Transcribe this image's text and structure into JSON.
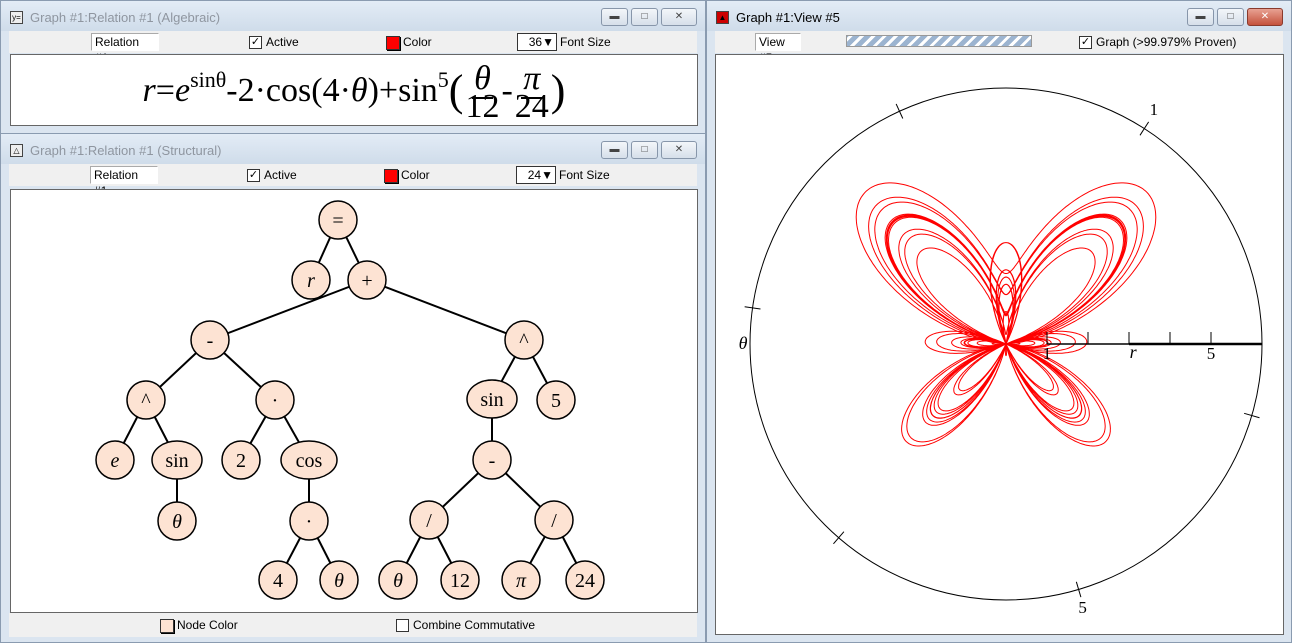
{
  "algebraic": {
    "title": "Graph #1:Relation #1 (Algebraic)",
    "title_icon": "y=",
    "relation_name": "Relation #1",
    "active_label": "Active",
    "active_checked": true,
    "color_label": "Color",
    "color": "#ff0000",
    "font_size": "36",
    "font_size_label": "Font Size",
    "equation": {
      "lhs": "r",
      "eq": "=",
      "base": "e",
      "exp": "sinθ",
      "mid": "-2·cos(4·",
      "theta": "θ",
      "close": ")+sin",
      "pow": "5",
      "lparen": "(",
      "num1": "θ",
      "den1": "12",
      "minus": "-",
      "num2": "π",
      "den2": "24",
      "rparen": ")"
    }
  },
  "structural": {
    "title": "Graph #1:Relation #1 (Structural)",
    "relation_name": "Relation #1",
    "active_label": "Active",
    "active_checked": true,
    "color_label": "Color",
    "color": "#ff0000",
    "font_size": "24",
    "font_size_label": "Font Size",
    "node_color_label": "Node Color",
    "node_color": "#fde3d3",
    "combine_commutative_label": "Combine Commutative",
    "combine_commutative_checked": false,
    "tree": [
      {
        "id": "n0",
        "label": "=",
        "parent": null
      },
      {
        "id": "n1",
        "label": "r",
        "parent": "n0",
        "italic": true
      },
      {
        "id": "n2",
        "label": "+",
        "parent": "n0"
      },
      {
        "id": "n3",
        "label": "-",
        "parent": "n2"
      },
      {
        "id": "n4",
        "label": "^",
        "parent": "n2"
      },
      {
        "id": "n5",
        "label": "^",
        "parent": "n3"
      },
      {
        "id": "n6",
        "label": "·",
        "parent": "n3"
      },
      {
        "id": "n7",
        "label": "sin",
        "parent": "n4"
      },
      {
        "id": "n8",
        "label": "5",
        "parent": "n4"
      },
      {
        "id": "n9",
        "label": "e",
        "parent": "n5",
        "italic": true
      },
      {
        "id": "n10",
        "label": "sin",
        "parent": "n5"
      },
      {
        "id": "n11",
        "label": "2",
        "parent": "n6"
      },
      {
        "id": "n12",
        "label": "cos",
        "parent": "n6"
      },
      {
        "id": "n13",
        "label": "-",
        "parent": "n7"
      },
      {
        "id": "n14",
        "label": "θ",
        "parent": "n10",
        "italic": true
      },
      {
        "id": "n15",
        "label": "·",
        "parent": "n12"
      },
      {
        "id": "n16",
        "label": "/",
        "parent": "n13"
      },
      {
        "id": "n17",
        "label": "/",
        "parent": "n13"
      },
      {
        "id": "n18",
        "label": "4",
        "parent": "n15"
      },
      {
        "id": "n19",
        "label": "θ",
        "parent": "n15",
        "italic": true
      },
      {
        "id": "n20",
        "label": "θ",
        "parent": "n16",
        "italic": true
      },
      {
        "id": "n21",
        "label": "12",
        "parent": "n16"
      },
      {
        "id": "n22",
        "label": "π",
        "parent": "n17",
        "italic": true
      },
      {
        "id": "n23",
        "label": "24",
        "parent": "n17"
      }
    ]
  },
  "view": {
    "title": "Graph #1:View #5",
    "view_name": "View #5",
    "progress_percent": 100,
    "graph_label": "Graph (>99.979% Proven)",
    "graph_checked": true
  },
  "chart_data": {
    "type": "line",
    "coordinate_system": "polar",
    "equation": "r = e^sinθ - 2·cos(4·θ) + sin^5(θ/12 - π/24)",
    "theta_range": [
      0,
      75.398
    ],
    "series": [
      {
        "name": "Relation #1",
        "color": "#ff0000"
      }
    ],
    "r_axis": {
      "label": "r",
      "tick_values": [
        1,
        2,
        3,
        4,
        5
      ],
      "tick_labels": [
        "1",
        "5"
      ],
      "max": 6.27
    },
    "theta_axis": {
      "label": "θ",
      "tick_values": [
        1,
        2,
        3,
        4,
        5,
        6
      ],
      "tick_labels": [
        "1",
        "5"
      ]
    }
  }
}
